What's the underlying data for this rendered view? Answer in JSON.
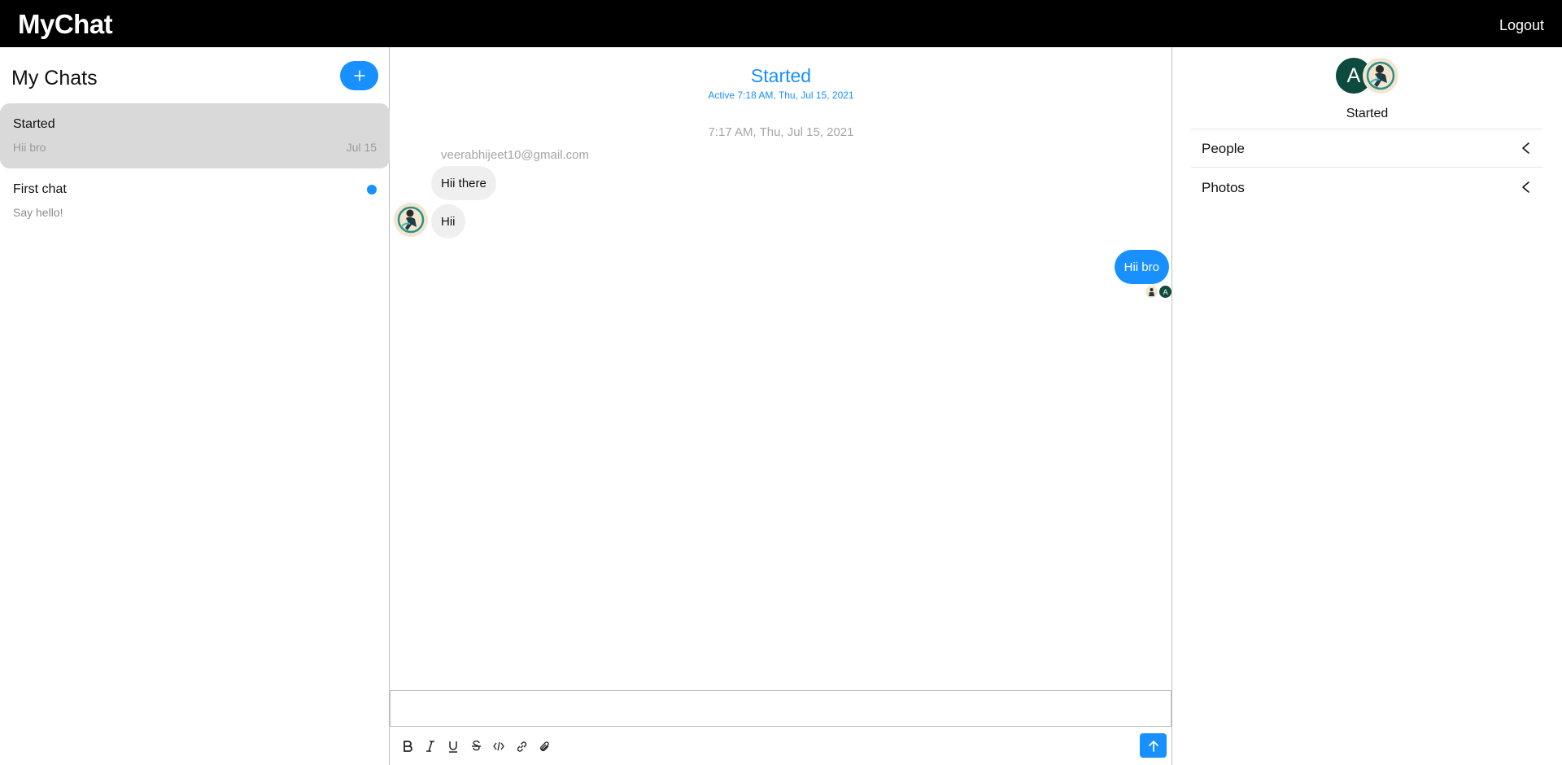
{
  "app": {
    "brand": "MyChat",
    "logout_label": "Logout"
  },
  "sidebar": {
    "title": "My Chats",
    "new_chat_icon": "plus-icon",
    "chats": [
      {
        "title": "Started",
        "last_message": "Hii bro",
        "date": "Jul 15",
        "active": true,
        "unread": false
      },
      {
        "title": "First chat",
        "last_message": "Say hello!",
        "date": "",
        "active": false,
        "unread": true
      }
    ]
  },
  "feed": {
    "title": "Started",
    "subtitle": "Active 7:18 AM, Thu, Jul 15, 2021",
    "timestamp": "7:17 AM, Thu, Jul 15, 2021",
    "sender_email": "veerabhijeet10@gmail.com",
    "messages": [
      {
        "text": "Hii there",
        "from": "theirs"
      },
      {
        "text": "Hii",
        "from": "theirs"
      },
      {
        "text": "Hii bro",
        "from": "mine"
      }
    ],
    "read_receipt_initial": "A",
    "composer_placeholder": "",
    "toolbar": [
      "bold-icon",
      "italic-icon",
      "underline-icon",
      "strikethrough-icon",
      "code-icon",
      "link-icon",
      "attachment-icon"
    ],
    "send_icon": "arrow-up-icon"
  },
  "settings": {
    "avatar_initial": "A",
    "title": "Started",
    "sections": [
      {
        "label": "People",
        "icon": "chevron-left-icon"
      },
      {
        "label": "Photos",
        "icon": "chevron-left-icon"
      }
    ]
  },
  "colors": {
    "accent": "#1890ff",
    "topbar": "#000000",
    "avatar_green": "#0c4b3e",
    "active_chat_bg": "#d9d9d9"
  }
}
